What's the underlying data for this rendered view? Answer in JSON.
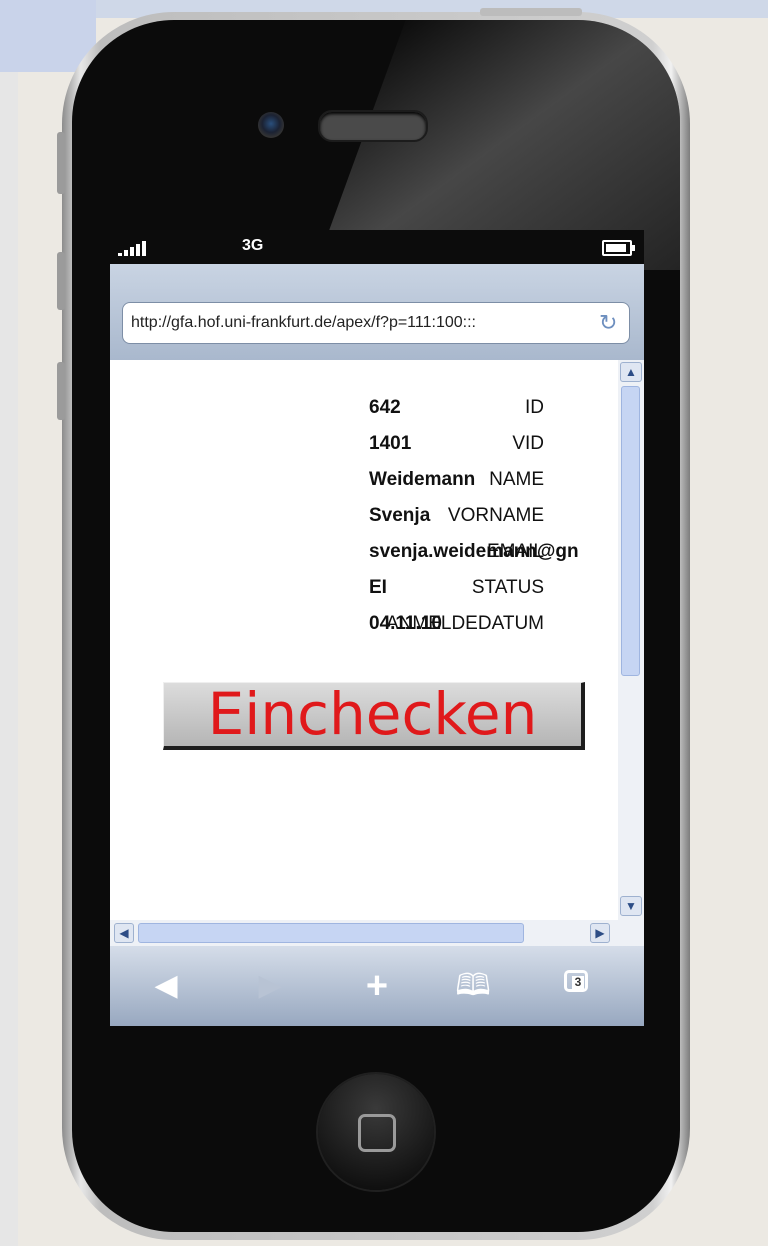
{
  "status_bar": {
    "network": "3G"
  },
  "browser": {
    "url": "http://gfa.hof.uni-frankfurt.de/apex/f?p=111:100:::",
    "reload_icon": "reload-icon"
  },
  "record": {
    "fields": [
      {
        "label": "ID",
        "value": "642"
      },
      {
        "label": "VID",
        "value": "1401"
      },
      {
        "label": "NAME",
        "value": "Weidemann"
      },
      {
        "label": "VORNAME",
        "value": "Svenja"
      },
      {
        "label": "EMAIL",
        "value": "svenja.weidemann@gn"
      },
      {
        "label": "STATUS",
        "value": "EI"
      },
      {
        "label": "ANMELDEDATUM",
        "value": "04.11.10"
      }
    ]
  },
  "action": {
    "checkin_label": "Einchecken"
  },
  "toolbar": {
    "back": "◀",
    "forward": "▶",
    "add": "+",
    "bookmarks": "🕮",
    "tabs_count": "3"
  },
  "colors": {
    "accent": "#e0191b",
    "toolbar": "#a9b8cd"
  }
}
